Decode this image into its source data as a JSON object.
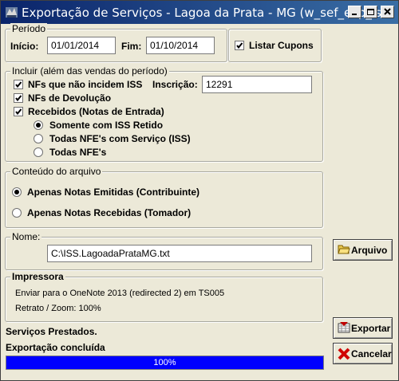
{
  "window": {
    "title": "Exportação de Serviços - Lagoa da Prata - MG (w_sef_exp_is...",
    "controls": [
      "minimize-icon",
      "maximize-icon",
      "close-icon"
    ]
  },
  "periodo": {
    "legend": "Período",
    "inicio_label": "Início:",
    "inicio_value": "01/01/2014",
    "fim_label": "Fim:",
    "fim_value": "01/10/2014"
  },
  "listar_cupons": {
    "label": "Listar Cupons",
    "checked": true
  },
  "incluir": {
    "legend": "Incluir (além das vendas do período)",
    "nfs_iss_label": "NFs que não incidem ISS",
    "inscricao_label": "Inscrição:",
    "inscricao_value": "12291",
    "nfs_devolucao_label": "NFs de Devolução",
    "recebidos_label": "Recebidos (Notas de Entrada)",
    "radio_iss_retido": "Somente com ISS Retido",
    "radio_nfe_servico": "Todas NFE's com Serviço (ISS)",
    "radio_todas_nfe": "Todas NFE's"
  },
  "conteudo": {
    "legend": "Conteúdo do arquivo",
    "opt1": "Apenas Notas Emitidas (Contribuinte)",
    "opt2": "Apenas Notas Recebidas (Tomador)"
  },
  "nome": {
    "legend": "Nome:",
    "value": "C:\\ISS.LagoadaPrataMG.txt"
  },
  "impressora": {
    "legend": "Impressora",
    "line1": "Enviar para o OneNote 2013 (redirected 2) em TS005",
    "line2": "Retrato / Zoom: 100%"
  },
  "buttons": {
    "arquivo": "Arquivo",
    "exportar": "Exportar",
    "cancelar": "Cancelar"
  },
  "status": {
    "line1": "Serviços Prestados.",
    "line2": "Exportação concluída",
    "progress_text": "100%",
    "progress_value": 1.0
  },
  "colors": {
    "titlebar": "#0a246a",
    "window_bg": "#ece9d8",
    "progress_fill": "#0000ff"
  }
}
